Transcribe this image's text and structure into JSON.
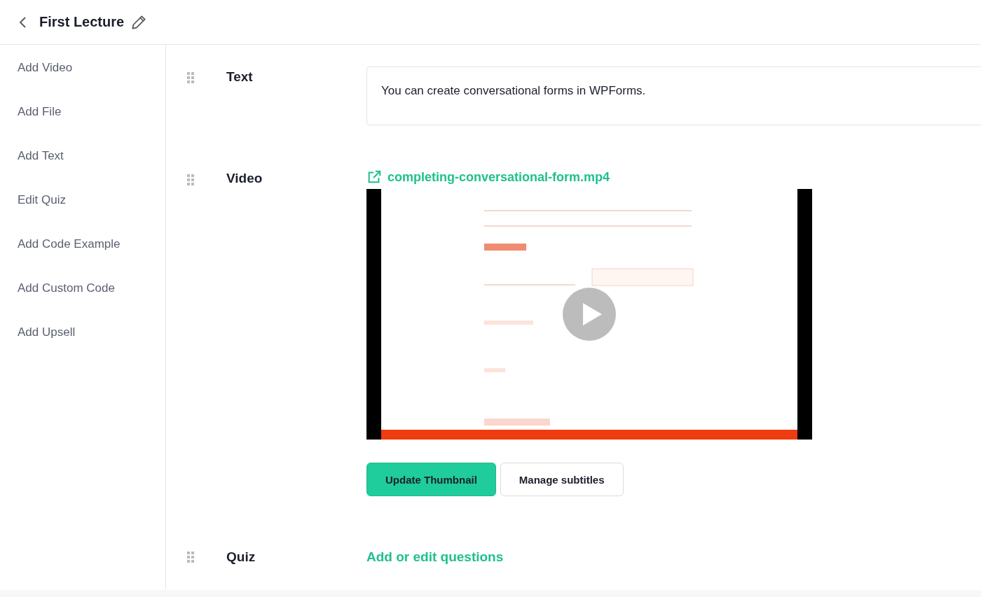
{
  "header": {
    "title": "First Lecture"
  },
  "sidebar": {
    "items": [
      {
        "label": "Add Video"
      },
      {
        "label": "Add File"
      },
      {
        "label": "Add Text"
      },
      {
        "label": "Edit Quiz"
      },
      {
        "label": "Add Code Example"
      },
      {
        "label": "Add Custom Code"
      },
      {
        "label": "Add Upsell"
      }
    ]
  },
  "sections": [
    {
      "kind": "text",
      "label": "Text",
      "content": "You can create conversational forms in WPForms."
    },
    {
      "kind": "video",
      "label": "Video",
      "file": "completing-conversational-form.mp4",
      "video": {
        "kind": "picture"
      },
      "buttons": [
        {
          "label": "Update Thumbnail",
          "primary": true
        },
        {
          "label": "Manage subtitles",
          "primary": false
        }
      ]
    },
    {
      "kind": "quiz",
      "label": "Quiz",
      "link": "Add or edit questions"
    }
  ]
}
